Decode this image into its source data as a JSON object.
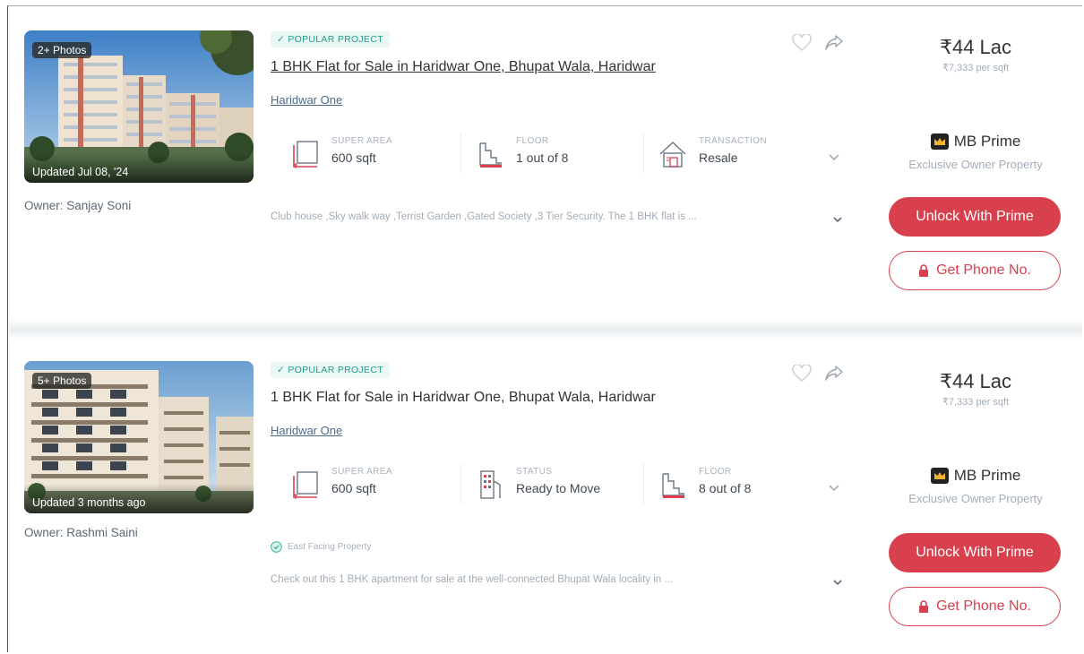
{
  "listings": [
    {
      "photos_badge": "2+ Photos",
      "updated": "Updated Jul 08, '24",
      "owner": "Owner: Sanjay Soni",
      "popular_badge": "✓ POPULAR PROJECT",
      "title": "1 BHK Flat for Sale in Haridwar One, Bhupat Wala, Haridwar",
      "project": "Haridwar One",
      "summary": [
        {
          "label": "SUPER AREA",
          "value": "600 sqft",
          "icon": "area-icon"
        },
        {
          "label": "FLOOR",
          "value": "1 out of 8",
          "icon": "floor-icon"
        },
        {
          "label": "TRANSACTION",
          "value": "Resale",
          "icon": "house-icon"
        }
      ],
      "description": "Club house ,Sky walk way ,Terrist Garden ,Gated Society ,3 Tier Security. The 1 BHK flat is ...",
      "price": "₹44 Lac",
      "price_per_sqft": "₹7,333 per sqft",
      "prime_title": "MB Prime",
      "prime_sub": "Exclusive Owner Property",
      "unlock_label": "Unlock With Prime",
      "phone_label": "Get Phone No."
    },
    {
      "photos_badge": "5+ Photos",
      "updated": "Updated 3 months ago",
      "owner": "Owner: Rashmi Saini",
      "popular_badge": "✓ POPULAR PROJECT",
      "title": "1 BHK Flat for Sale in Haridwar One, Bhupat Wala, Haridwar",
      "project": "Haridwar One",
      "summary": [
        {
          "label": "SUPER AREA",
          "value": "600 sqft",
          "icon": "area-icon"
        },
        {
          "label": "STATUS",
          "value": "Ready to Move",
          "icon": "building-icon"
        },
        {
          "label": "FLOOR",
          "value": "8 out of 8",
          "icon": "floor-icon"
        }
      ],
      "east_facing": "East Facing Property",
      "description": "Check out this 1 BHK apartment for sale at the well-connected Bhupat Wala locality in ...",
      "price": "₹44 Lac",
      "price_per_sqft": "₹7,333 per sqft",
      "prime_title": "MB Prime",
      "prime_sub": "Exclusive Owner Property",
      "unlock_label": "Unlock With Prime",
      "phone_label": "Get Phone No."
    }
  ],
  "colors": {
    "accent": "#d8404e",
    "popular": "#1f9d8a",
    "muted": "#a3adb8"
  }
}
